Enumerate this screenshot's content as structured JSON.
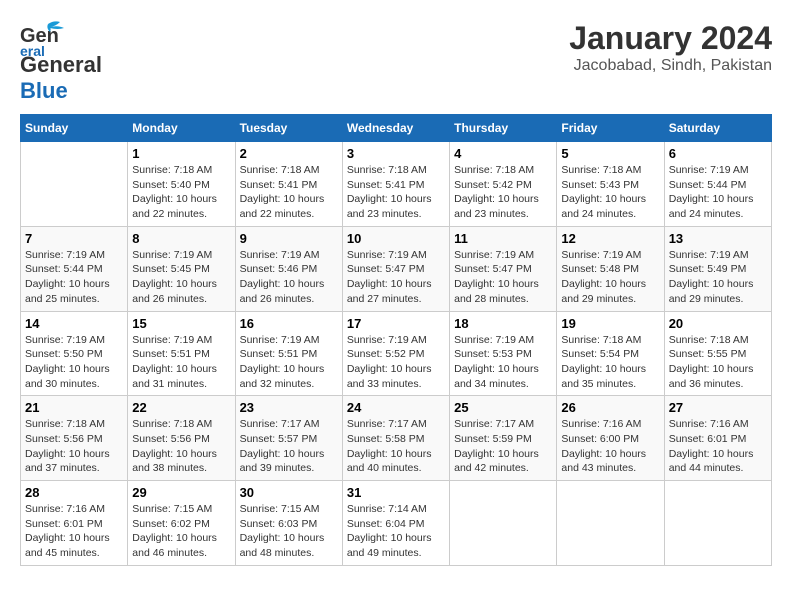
{
  "header": {
    "logo_line1": "General",
    "logo_line2": "Blue",
    "title": "January 2024",
    "subtitle": "Jacobabad, Sindh, Pakistan"
  },
  "weekdays": [
    "Sunday",
    "Monday",
    "Tuesday",
    "Wednesday",
    "Thursday",
    "Friday",
    "Saturday"
  ],
  "weeks": [
    [
      {
        "day": "",
        "info": ""
      },
      {
        "day": "1",
        "info": "Sunrise: 7:18 AM\nSunset: 5:40 PM\nDaylight: 10 hours\nand 22 minutes."
      },
      {
        "day": "2",
        "info": "Sunrise: 7:18 AM\nSunset: 5:41 PM\nDaylight: 10 hours\nand 22 minutes."
      },
      {
        "day": "3",
        "info": "Sunrise: 7:18 AM\nSunset: 5:41 PM\nDaylight: 10 hours\nand 23 minutes."
      },
      {
        "day": "4",
        "info": "Sunrise: 7:18 AM\nSunset: 5:42 PM\nDaylight: 10 hours\nand 23 minutes."
      },
      {
        "day": "5",
        "info": "Sunrise: 7:18 AM\nSunset: 5:43 PM\nDaylight: 10 hours\nand 24 minutes."
      },
      {
        "day": "6",
        "info": "Sunrise: 7:19 AM\nSunset: 5:44 PM\nDaylight: 10 hours\nand 24 minutes."
      }
    ],
    [
      {
        "day": "7",
        "info": "Sunrise: 7:19 AM\nSunset: 5:44 PM\nDaylight: 10 hours\nand 25 minutes."
      },
      {
        "day": "8",
        "info": "Sunrise: 7:19 AM\nSunset: 5:45 PM\nDaylight: 10 hours\nand 26 minutes."
      },
      {
        "day": "9",
        "info": "Sunrise: 7:19 AM\nSunset: 5:46 PM\nDaylight: 10 hours\nand 26 minutes."
      },
      {
        "day": "10",
        "info": "Sunrise: 7:19 AM\nSunset: 5:47 PM\nDaylight: 10 hours\nand 27 minutes."
      },
      {
        "day": "11",
        "info": "Sunrise: 7:19 AM\nSunset: 5:47 PM\nDaylight: 10 hours\nand 28 minutes."
      },
      {
        "day": "12",
        "info": "Sunrise: 7:19 AM\nSunset: 5:48 PM\nDaylight: 10 hours\nand 29 minutes."
      },
      {
        "day": "13",
        "info": "Sunrise: 7:19 AM\nSunset: 5:49 PM\nDaylight: 10 hours\nand 29 minutes."
      }
    ],
    [
      {
        "day": "14",
        "info": "Sunrise: 7:19 AM\nSunset: 5:50 PM\nDaylight: 10 hours\nand 30 minutes."
      },
      {
        "day": "15",
        "info": "Sunrise: 7:19 AM\nSunset: 5:51 PM\nDaylight: 10 hours\nand 31 minutes."
      },
      {
        "day": "16",
        "info": "Sunrise: 7:19 AM\nSunset: 5:51 PM\nDaylight: 10 hours\nand 32 minutes."
      },
      {
        "day": "17",
        "info": "Sunrise: 7:19 AM\nSunset: 5:52 PM\nDaylight: 10 hours\nand 33 minutes."
      },
      {
        "day": "18",
        "info": "Sunrise: 7:19 AM\nSunset: 5:53 PM\nDaylight: 10 hours\nand 34 minutes."
      },
      {
        "day": "19",
        "info": "Sunrise: 7:18 AM\nSunset: 5:54 PM\nDaylight: 10 hours\nand 35 minutes."
      },
      {
        "day": "20",
        "info": "Sunrise: 7:18 AM\nSunset: 5:55 PM\nDaylight: 10 hours\nand 36 minutes."
      }
    ],
    [
      {
        "day": "21",
        "info": "Sunrise: 7:18 AM\nSunset: 5:56 PM\nDaylight: 10 hours\nand 37 minutes."
      },
      {
        "day": "22",
        "info": "Sunrise: 7:18 AM\nSunset: 5:56 PM\nDaylight: 10 hours\nand 38 minutes."
      },
      {
        "day": "23",
        "info": "Sunrise: 7:17 AM\nSunset: 5:57 PM\nDaylight: 10 hours\nand 39 minutes."
      },
      {
        "day": "24",
        "info": "Sunrise: 7:17 AM\nSunset: 5:58 PM\nDaylight: 10 hours\nand 40 minutes."
      },
      {
        "day": "25",
        "info": "Sunrise: 7:17 AM\nSunset: 5:59 PM\nDaylight: 10 hours\nand 42 minutes."
      },
      {
        "day": "26",
        "info": "Sunrise: 7:16 AM\nSunset: 6:00 PM\nDaylight: 10 hours\nand 43 minutes."
      },
      {
        "day": "27",
        "info": "Sunrise: 7:16 AM\nSunset: 6:01 PM\nDaylight: 10 hours\nand 44 minutes."
      }
    ],
    [
      {
        "day": "28",
        "info": "Sunrise: 7:16 AM\nSunset: 6:01 PM\nDaylight: 10 hours\nand 45 minutes."
      },
      {
        "day": "29",
        "info": "Sunrise: 7:15 AM\nSunset: 6:02 PM\nDaylight: 10 hours\nand 46 minutes."
      },
      {
        "day": "30",
        "info": "Sunrise: 7:15 AM\nSunset: 6:03 PM\nDaylight: 10 hours\nand 48 minutes."
      },
      {
        "day": "31",
        "info": "Sunrise: 7:14 AM\nSunset: 6:04 PM\nDaylight: 10 hours\nand 49 minutes."
      },
      {
        "day": "",
        "info": ""
      },
      {
        "day": "",
        "info": ""
      },
      {
        "day": "",
        "info": ""
      }
    ]
  ]
}
